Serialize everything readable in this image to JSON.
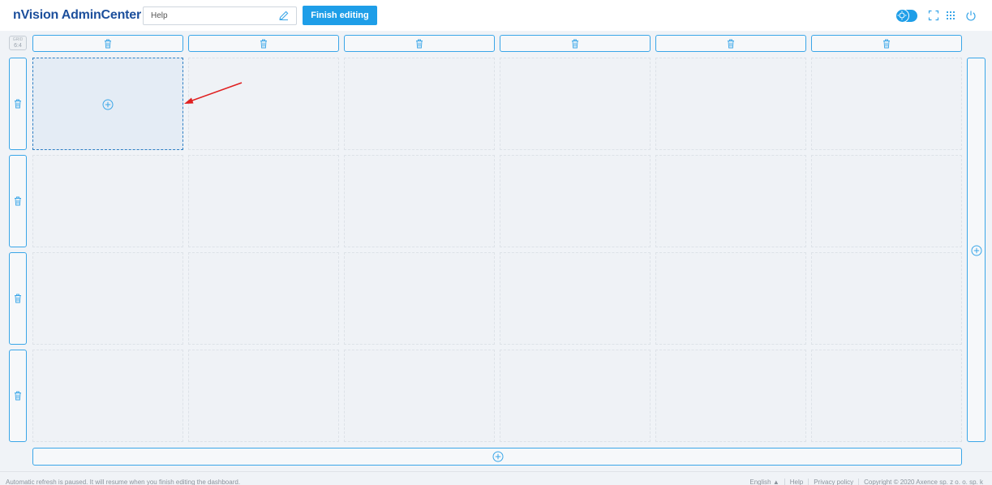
{
  "app": {
    "title": "nVision AdminCenter"
  },
  "toolbar": {
    "dashboard_name_value": "Help",
    "finish_label": "Finish editing"
  },
  "grid": {
    "badge_label": "GRID",
    "badge_value": "6:4",
    "columns": 6,
    "rows": 4,
    "active_cell": {
      "row": 1,
      "col": 1
    }
  },
  "icons": {
    "delete": "trash-icon",
    "add": "plus-circle-icon",
    "edit": "pencil-icon",
    "theme_toggle": "theme-toggle-icon",
    "fullscreen": "fullscreen-icon",
    "apps": "apps-grid-icon",
    "power": "power-icon"
  },
  "colors": {
    "accent": "#1e9ee8",
    "brand": "#1c4f9c",
    "annotation_arrow": "#e02020"
  },
  "footer": {
    "status": "Automatic refresh is paused. It will resume when you finish editing the dashboard.",
    "language": "English ▲",
    "help": "Help",
    "privacy": "Privacy policy",
    "copyright": "Copyright © 2020  Axence sp. z o. o. sp. k"
  }
}
